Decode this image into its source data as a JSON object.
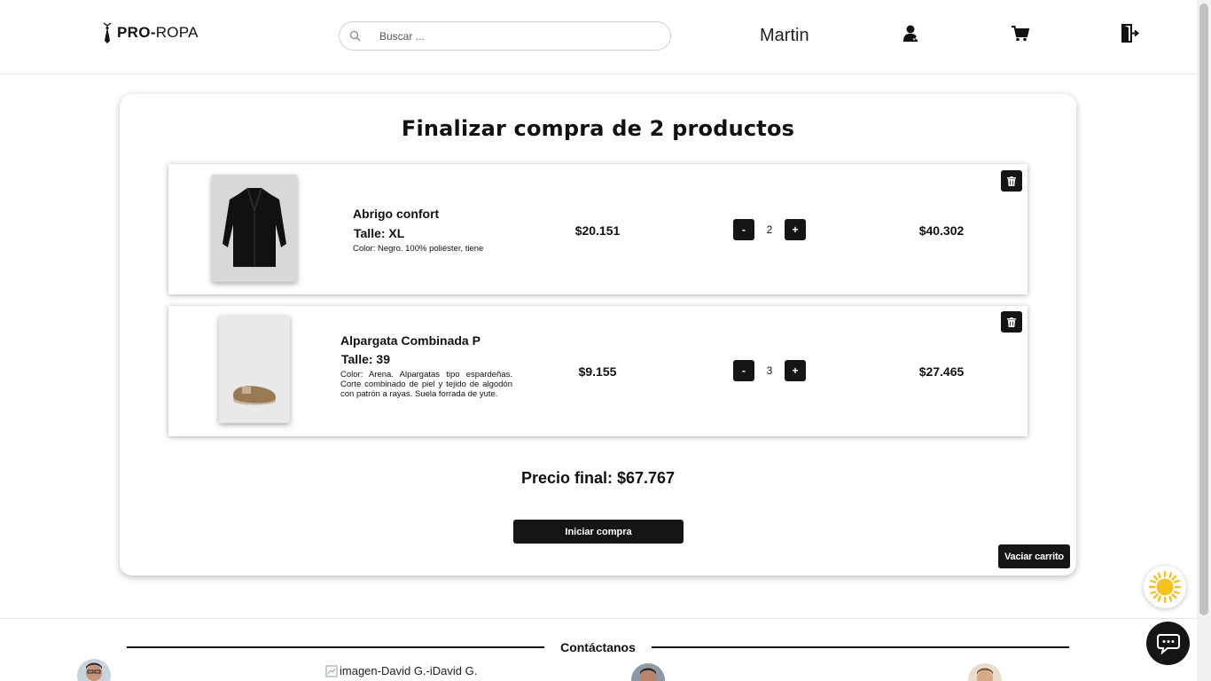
{
  "header": {
    "logo_bold": "PRO-",
    "logo_light": "ROPA",
    "search_placeholder": "Buscar ...",
    "username": "Martin",
    "icons": [
      "user-icon",
      "cart-icon",
      "logout-icon"
    ]
  },
  "cart": {
    "title": "Finalizar compra de 2 productos",
    "items": [
      {
        "name": "Abrigo confort",
        "size": "Talle: XL",
        "description": "Color: Negro. 100% poliéster, tiene",
        "unit_price": "$20.151",
        "qty_minus": "-",
        "quantity": "2",
        "qty_plus": "+",
        "total": "$40.302",
        "image": "coat-image"
      },
      {
        "name": "Alpargata Combinada P",
        "size": "Talle: 39",
        "description": "Color: Arena. Alpargatas tipo espardeñas. Corte combinado de piel y tejido de algodón con patrón a rayas. Suela forrada de yute.",
        "unit_price": "$9.155",
        "qty_minus": "-",
        "quantity": "3",
        "qty_plus": "+",
        "total": "$27.465",
        "image": "espadrille-image"
      }
    ],
    "final_price": "Precio final: $67.767",
    "buy_button": "Iniciar compra",
    "empty_button": "Vaciar carrito"
  },
  "footer": {
    "contact_title": "Contáctanos",
    "broken_image_alt": "imagen-David G.-iDavid G."
  },
  "colors": {
    "button_bg": "#151515",
    "accent_tab": "#2a6ad9",
    "sun": "#f7c11d"
  }
}
